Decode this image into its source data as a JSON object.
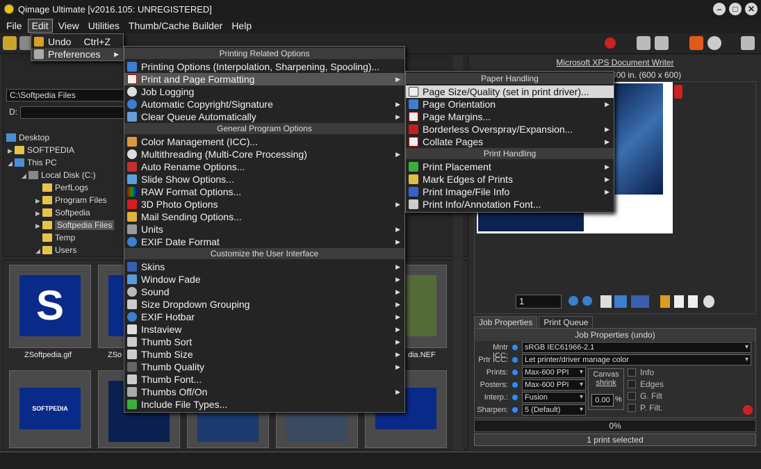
{
  "window": {
    "title": "Qimage Ultimate [v2016.105: UNREGISTERED]",
    "controls": [
      "–",
      "□",
      "✕"
    ]
  },
  "menubar": [
    "File",
    "Edit",
    "View",
    "Utilities",
    "Thumb/Cache Builder",
    "Help"
  ],
  "folder_panel": {
    "path_c": "C:\\Softpedia Files",
    "path_d": "D:",
    "tree": [
      {
        "label": "Desktop",
        "icon": "desktop-icon"
      },
      {
        "label": "SOFTPEDIA",
        "icon": "folder-icon"
      },
      {
        "label": "This PC",
        "icon": "computer-icon"
      },
      {
        "label": "Local Disk (C:)",
        "icon": "disk-icon"
      },
      {
        "label": "PerfLogs",
        "icon": "folder-icon"
      },
      {
        "label": "Program Files",
        "icon": "folder-icon"
      },
      {
        "label": "Softpedia",
        "icon": "folder-icon"
      },
      {
        "label": "Softpedia Files",
        "icon": "folder-icon"
      },
      {
        "label": "Temp",
        "icon": "folder-icon"
      },
      {
        "label": "Users",
        "icon": "folder-icon"
      }
    ]
  },
  "thumbnails": {
    "labels": [
      "ZSoftpedia.gif",
      "ZSo",
      "dia.NEF"
    ],
    "thumb_text": "SOFTPEDIA"
  },
  "edit_menu": {
    "undo": {
      "label": "Undo",
      "shortcut": "Ctrl+Z"
    },
    "preferences": "Preferences"
  },
  "preferences_menu": {
    "sections": [
      "Printing Related Options",
      "General Program Options",
      "Customize the User Interface"
    ],
    "printing": [
      "Printing Options (Interpolation, Sharpening, Spooling)...",
      "Print and Page Formatting",
      "Job Logging",
      "Automatic Copyright/Signature",
      "Clear Queue Automatically"
    ],
    "general": [
      "Color Management (ICC)...",
      "Multithreading (Multi-Core Processing)",
      "Auto Rename Options...",
      "Slide Show Options...",
      "RAW Format Options...",
      "3D Photo Options",
      "Mail Sending Options...",
      "Units",
      "EXIF Date Format"
    ],
    "ui": [
      "Skins",
      "Window Fade",
      "Sound",
      "Size Dropdown Grouping",
      "EXIF Hotbar",
      "Instaview",
      "Thumb Sort",
      "Thumb Size",
      "Thumb Quality",
      "Thumb Font...",
      "Thumbs Off/On",
      "Include File Types..."
    ]
  },
  "print_format_menu": {
    "sections": [
      "Paper Handling",
      "Print Handling"
    ],
    "paper": [
      "Page Size/Quality (set in print driver)...",
      "Page Orientation",
      "Page Margins...",
      "Borderless Overspray/Expansion...",
      "Collate Pages"
    ],
    "print": [
      "Print Placement",
      "Mark Edges of Prints",
      "Print Image/File Info",
      "Print Info/Annotation Font..."
    ]
  },
  "preview": {
    "printer": "Microsoft XPS Document Writer",
    "page_size": "600 in.  (600 x 600)",
    "page_number": "1"
  },
  "job_properties": {
    "tabs": [
      "Job Properties",
      "Print Queue"
    ],
    "title": "Job Properties (undo)",
    "mntr_icc": {
      "label": "Mntr ICC:",
      "value": "sRGB IEC61966-2.1"
    },
    "prtr_icc": {
      "label": "Prtr ICC:",
      "value": "Let printer/driver manage color"
    },
    "prints": {
      "label": "Prints:",
      "value": "Max-600 PPI"
    },
    "posters": {
      "label": "Posters:",
      "value": "Max-600 PPI"
    },
    "interp": {
      "label": "Interp.:",
      "value": "Fusion"
    },
    "sharpen": {
      "label": "Sharpen:",
      "value": "5 (Default)"
    },
    "canvas_label": "Canvas",
    "canvas_action": "shrink",
    "canvas_value": "0.00",
    "canvas_unit": "%",
    "checkboxes": [
      "Info",
      "Edges",
      "G. Filt",
      "P. Filt."
    ]
  },
  "progress": "0%",
  "status": "1 print selected",
  "colors": {
    "accent": "#2e8bff",
    "highlight": "#d9d9d9",
    "menu_bg": "#242424"
  }
}
